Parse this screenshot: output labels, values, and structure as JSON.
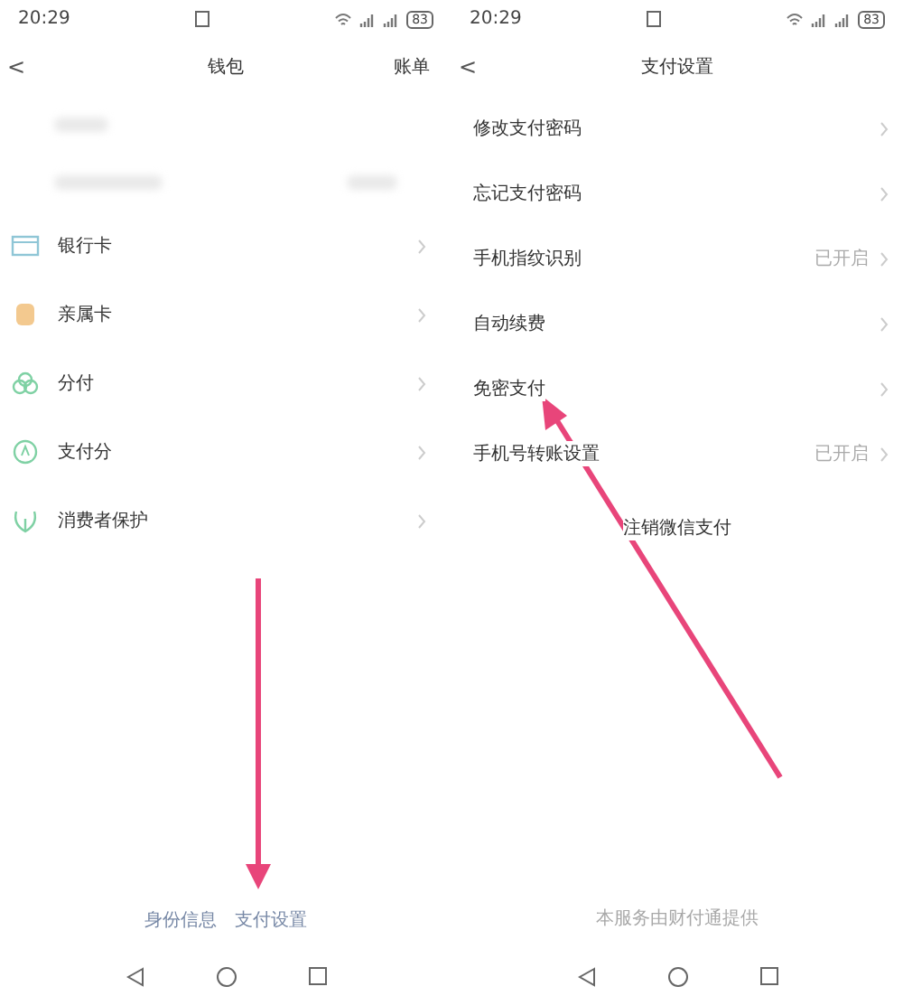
{
  "wallet_screen": {
    "status_bar": {
      "time": "20:29",
      "battery": "83"
    },
    "header": {
      "back": "<",
      "title": "钱包",
      "action": "账单"
    },
    "items": [
      {
        "label": "银行卡",
        "color": "#8fc6d6"
      },
      {
        "label": "亲属卡",
        "color": "#f3c98f"
      },
      {
        "label": "分付",
        "color": "#7fd1a4"
      },
      {
        "label": "支付分",
        "color": "#7fd1a4"
      },
      {
        "label": "消费者保护",
        "color": "#7fd1a4"
      }
    ],
    "footer_links": [
      "身份信息",
      "支付设置"
    ]
  },
  "payment_settings_screen": {
    "status_bar": {
      "time": "20:29",
      "battery": "83"
    },
    "header": {
      "back": "<",
      "title": "支付设置"
    },
    "items": [
      {
        "label": "修改支付密码"
      },
      {
        "label": "忘记支付密码"
      },
      {
        "label": "手机指纹识别",
        "value": "已开启"
      },
      {
        "label": "自动续费"
      },
      {
        "label": "免密支付"
      },
      {
        "label": "手机号转账设置",
        "value": "已开启"
      }
    ],
    "cancel_link": "注销微信支付",
    "footer_note": "本服务由财付通提供"
  }
}
